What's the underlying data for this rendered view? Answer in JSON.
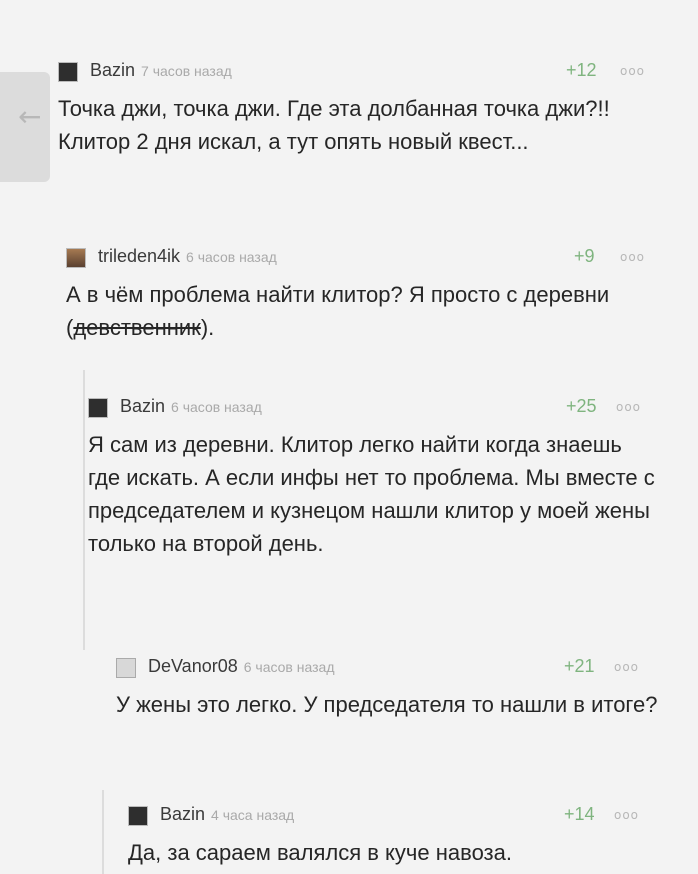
{
  "comments": [
    {
      "author": "Bazin",
      "time": "7 часов назад",
      "score": "+12",
      "more": "ooo",
      "avatar": "dark-avatar",
      "text": "Точка джи, точка джи. Где эта долбанная точка джи?!! Клитор 2 дня искал, а тут опять новый квест..."
    },
    {
      "author": "trileden4ik",
      "time": "6 часов назад",
      "score": "+9",
      "more": "ooo",
      "avatar": "photo-avatar",
      "text_before": "А в чём проблема найти клитор? Я просто с деревни (",
      "text_strike": "девственник",
      "text_after": ")."
    },
    {
      "author": "Bazin",
      "time": "6 часов назад",
      "score": "+25",
      "more": "ooo",
      "avatar": "dark-avatar",
      "text": "Я сам из деревни. Клитор легко найти когда знаешь где искать. А если инфы нет то проблема. Мы вместе с председателем и кузнецом нашли клитор у моей жены только на второй день."
    },
    {
      "author": "DeVanor08",
      "time": "6 часов назад",
      "score": "+21",
      "more": "ooo",
      "avatar": "light-avatar",
      "text": "У жены это легко. У председателя то нашли в итоге?"
    },
    {
      "author": "Bazin",
      "time": "4 часа назад",
      "score": "+14",
      "more": "ooo",
      "avatar": "dark-avatar",
      "text": "Да, за сараем валялся в куче навоза."
    }
  ],
  "icons": {
    "back": "arrow-left-icon"
  }
}
